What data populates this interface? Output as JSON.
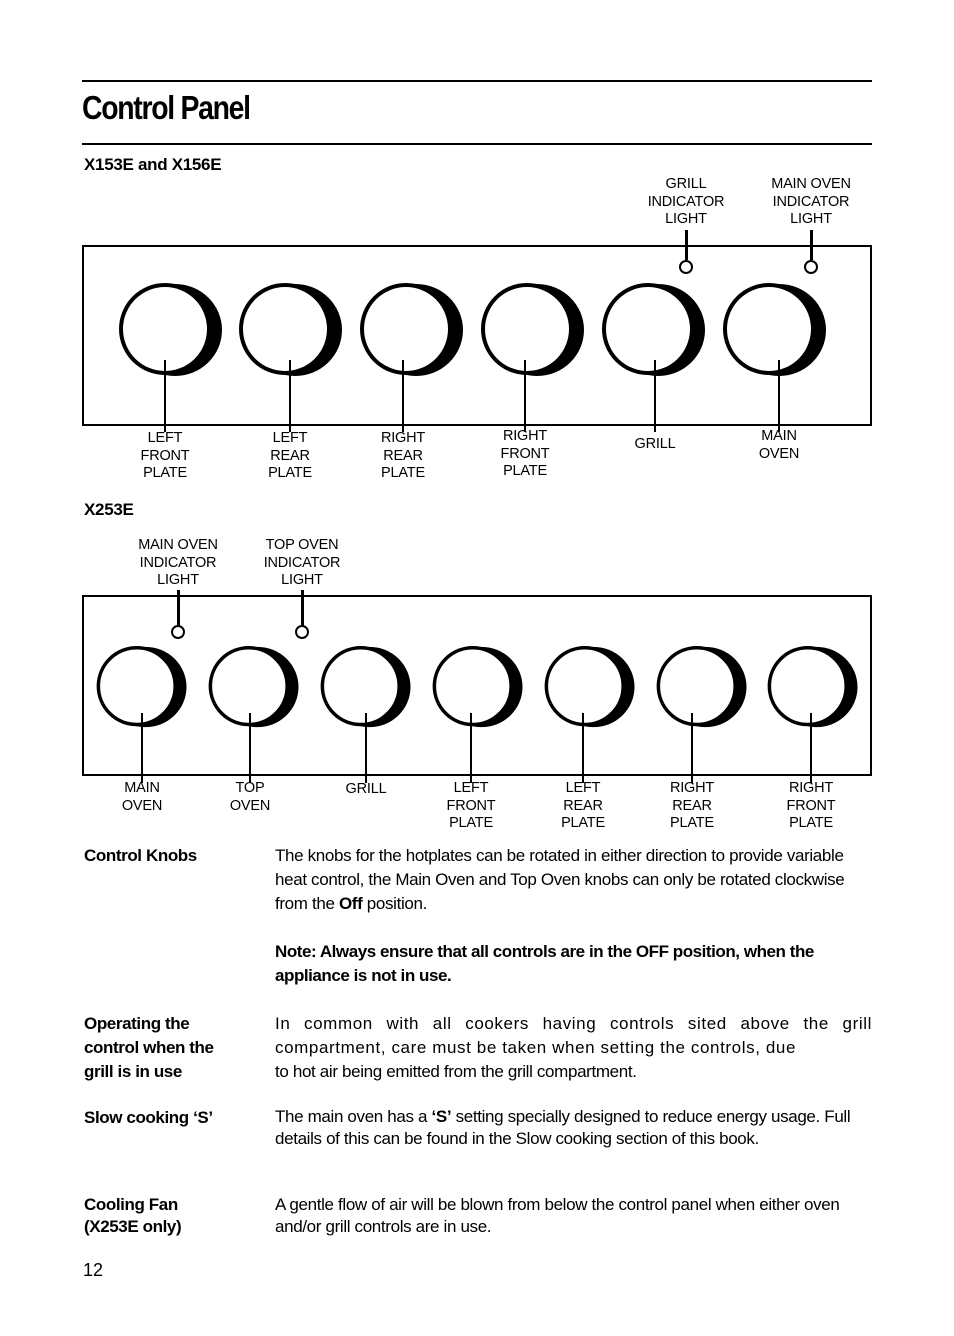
{
  "page": {
    "title": "Control Panel",
    "page_number": "12"
  },
  "diagram1": {
    "model": "X153E and X156E",
    "indicators": [
      {
        "label": "GRILL\nINDICATOR\nLIGHT"
      },
      {
        "label": "MAIN OVEN\nINDICATOR\nLIGHT"
      }
    ],
    "knobs": [
      {
        "label": "LEFT\nFRONT\nPLATE"
      },
      {
        "label": "LEFT\nREAR\nPLATE"
      },
      {
        "label": "RIGHT\nREAR\nPLATE"
      },
      {
        "label": "RIGHT\nFRONT\nPLATE"
      },
      {
        "label": "GRILL"
      },
      {
        "label": "MAIN\nOVEN"
      }
    ]
  },
  "diagram2": {
    "model": "X253E",
    "indicators": [
      {
        "label": "MAIN OVEN\nINDICATOR\nLIGHT"
      },
      {
        "label": "TOP OVEN\nINDICATOR\nLIGHT"
      }
    ],
    "knobs": [
      {
        "label": "MAIN\nOVEN"
      },
      {
        "label": "TOP\nOVEN"
      },
      {
        "label": "GRILL"
      },
      {
        "label": "LEFT\nFRONT\nPLATE"
      },
      {
        "label": "LEFT\nREAR\nPLATE"
      },
      {
        "label": "RIGHT\nREAR\nPLATE"
      },
      {
        "label": "RIGHT\nFRONT\nPLATE"
      }
    ]
  },
  "sections": {
    "control_knobs": {
      "heading": "Control Knobs",
      "text_pre": "The knobs for the hotplates can be rotated in either direction to provide variable heat control, the  Main Oven and Top Oven knobs  can only be rotated clockwise from the ",
      "text_bold": "Off",
      "text_post": " position.",
      "note": "Note: Always ensure that all controls are in the OFF position, when the appliance is not in use."
    },
    "operating_grill": {
      "heading": "Operating the\ncontrol when the\ngrill is in use",
      "text_main": "In common with all cookers having controls sited above the grill compartment, care must be taken when setting the controls, due",
      "text_last": "to hot air being emitted from the grill compartment."
    },
    "slow_cooking": {
      "heading": "Slow cooking ‘S’",
      "text_pre": "The main oven has a ",
      "text_bold": "‘S’",
      "text_post": " setting specially designed to reduce energy usage. Full details of this can be found in the Slow cooking section of this book."
    },
    "cooling_fan": {
      "heading": "Cooling Fan\n(X253E only)",
      "text": "A gentle flow of air will be blown from below the control panel when either oven and/or grill controls are in use."
    }
  }
}
